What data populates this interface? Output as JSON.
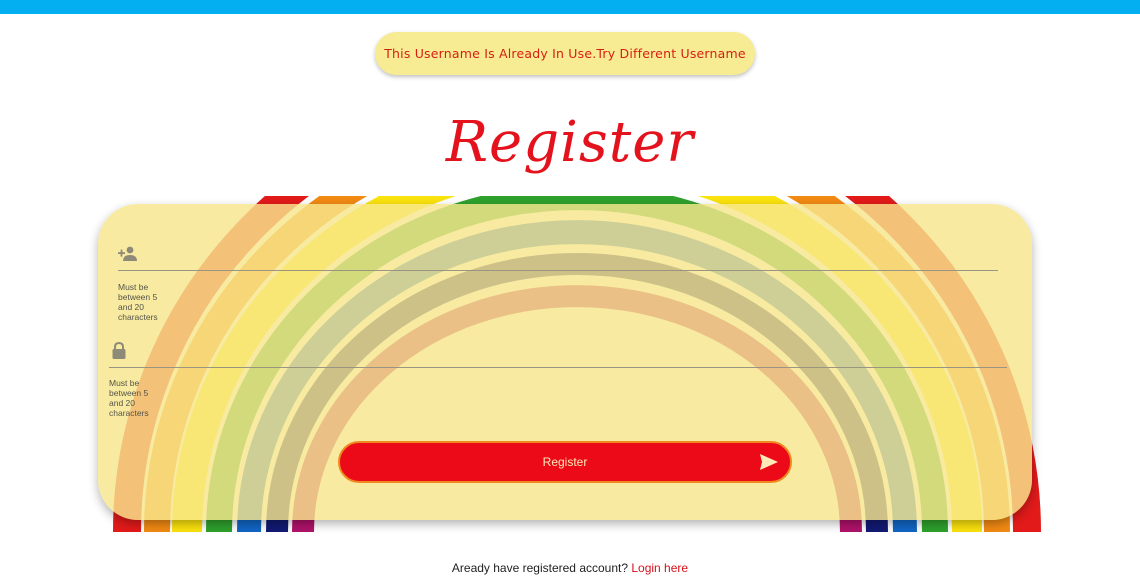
{
  "alert": {
    "message": "This Username Is Already In Use.Try Different Username"
  },
  "page": {
    "title": "Register"
  },
  "form": {
    "username": {
      "hint": "Must be between 5 and 20 characters",
      "icon": "person-add-icon",
      "value": "",
      "placeholder": ""
    },
    "password": {
      "hint": "Must be between 5 and 20 characters",
      "icon": "lock-icon",
      "value": "",
      "placeholder": ""
    },
    "submit_label": "Register"
  },
  "footer": {
    "text": "Aready have registered account?",
    "link_label": "Login here"
  },
  "colors": {
    "topbar": "#03aff0",
    "accent": "#e4121c",
    "alert_bg": "#f7ec93",
    "card_bg": "#f6e78c"
  }
}
